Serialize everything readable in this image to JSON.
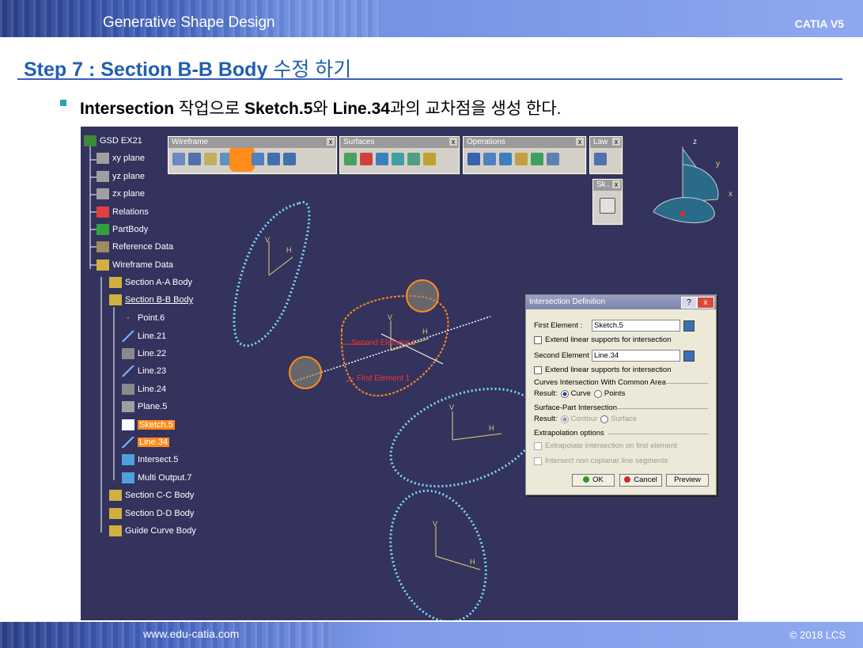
{
  "header": {
    "title": "Generative Shape Design",
    "brand": "CATIA V5"
  },
  "footer": {
    "url": "www.edu-catia.com",
    "copyright": "© 2018 LCS"
  },
  "step": {
    "prefix": "Step 7 : Section B-B Body",
    "suffix": "수정 하기"
  },
  "instruction": {
    "p1": "Intersection",
    "p2": "작업으로",
    "p3": "Sketch.5",
    "p4": "와",
    "p5": "Line.34",
    "p6": "과의 교차점을 생성 한다."
  },
  "tree": [
    {
      "label": "GSD EX21"
    },
    {
      "label": "xy plane"
    },
    {
      "label": "yz plane"
    },
    {
      "label": "zx plane"
    },
    {
      "label": "Relations"
    },
    {
      "label": "PartBody"
    },
    {
      "label": "Reference Data"
    },
    {
      "label": "Wireframe Data"
    },
    {
      "label": "Section A-A Body"
    },
    {
      "label": "Section B-B Body"
    },
    {
      "label": "Point.6"
    },
    {
      "label": "Line.21"
    },
    {
      "label": "Line.22"
    },
    {
      "label": "Line.23"
    },
    {
      "label": "Line.24"
    },
    {
      "label": "Plane.5"
    },
    {
      "label": "Sketch.5"
    },
    {
      "label": "Line.34"
    },
    {
      "label": "Intersect.5"
    },
    {
      "label": "Multi Output.7"
    },
    {
      "label": "Section C-C Body"
    },
    {
      "label": "Section D-D Body"
    },
    {
      "label": "Guide Curve Body"
    }
  ],
  "toolbars": {
    "wireframe": "Wireframe",
    "surfaces": "Surfaces",
    "operations": "Operations",
    "law": "Law",
    "sketcher": "Sk..",
    "close": "x"
  },
  "axes": {
    "z": "z",
    "y": "y",
    "x": "x"
  },
  "canvas_labels": {
    "second": "Second Element 1",
    "first": "First Element 1",
    "v": "V",
    "h": "H"
  },
  "dialog": {
    "title": "Intersection Definition",
    "help": "?",
    "close": "x",
    "first_label": "First Element :",
    "first_value": "Sketch.5",
    "extend1": "Extend linear supports for intersection",
    "second_label": "Second Element :",
    "second_value": "Line.34",
    "extend2": "Extend linear supports for intersection",
    "curves_group": "Curves Intersection With Common Area",
    "result_label": "Result:",
    "curve": "Curve",
    "points": "Points",
    "surface_group": "Surface-Part Intersection",
    "result_label2": "Result:",
    "contour": "Contour",
    "surface": "Surface",
    "extrap_group": "Extrapolation options",
    "extrap1": "Extrapolate intersection on first element",
    "extrap2": "Intersect non coplanar line segments",
    "ok": "OK",
    "cancel": "Cancel",
    "preview": "Preview"
  },
  "colors": {
    "accent": "#1f5fb0",
    "canvas": "#33335e",
    "highlight": "#ff8c1a",
    "curve": "#7fd8ff",
    "orange_curve": "#ff8c1a"
  }
}
